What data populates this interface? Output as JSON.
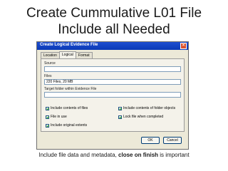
{
  "slide": {
    "title_line1": "Create Cummulative L01 File",
    "title_line2": "Include all Needed",
    "caption_prefix": "Include file data and metadata, ",
    "caption_bold": "close on finish",
    "caption_suffix": " is important"
  },
  "dialog": {
    "title": "Create Logical Evidence File",
    "tabs": [
      "Location",
      "Logical",
      "Format"
    ],
    "active_tab": "Logical",
    "source_label": "Source",
    "source_value": "",
    "files_label": "Files",
    "files_value": "220 Files, 20 MB",
    "target_label": "Target folder within Evidence File",
    "target_value": "",
    "options": [
      {
        "label": "Include contents of files",
        "checked": true
      },
      {
        "label": "Include contents of folder objects",
        "checked": true
      },
      {
        "label": "File in use",
        "checked": true
      },
      {
        "label": "Lock file when completed",
        "checked": true
      },
      {
        "label": "Include original extents",
        "checked": true
      }
    ],
    "ok_label": "OK",
    "cancel_label": "Cancel"
  },
  "colors": {
    "titlebar": "#0a39b5",
    "dialog_bg": "#ece9d8",
    "check": "#21a121"
  }
}
